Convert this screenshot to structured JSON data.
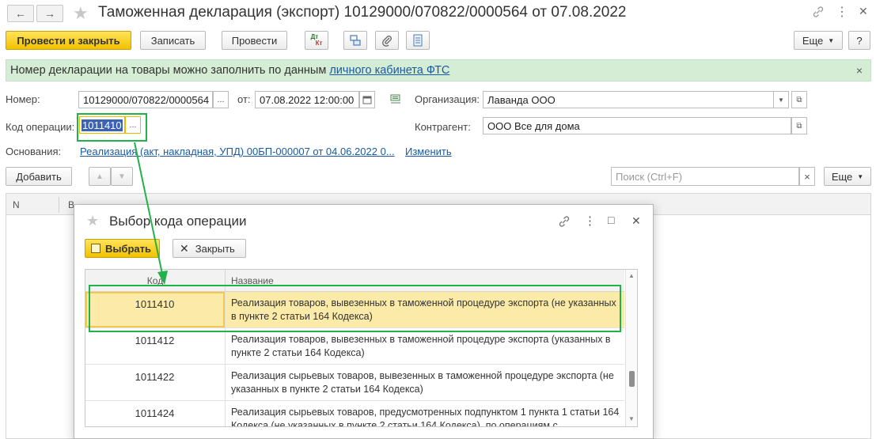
{
  "window": {
    "title": "Таможенная декларация (экспорт) 10129000/070822/0000564 от 07.08.2022",
    "back_glyph": "←",
    "forward_glyph": "→",
    "star_glyph": "★",
    "link_glyph": "🔗",
    "menu_glyph": "⋮",
    "maximize_glyph": "□",
    "close_glyph": "✕"
  },
  "toolbar": {
    "post_close": "Провести и закрыть",
    "save": "Записать",
    "post": "Провести",
    "dtkt_top": "Дт",
    "dtkt_bottom": "Кт",
    "more": "Еще",
    "help": "?"
  },
  "banner": {
    "text": "Номер декларации на товары можно заполнить по данным ",
    "link": "личного кабинета ФТС",
    "close_glyph": "×"
  },
  "form": {
    "number_label": "Номер:",
    "number_value": "10129000/070822/0000564",
    "date_label": "от:",
    "date_value": "07.08.2022 12:00:00",
    "org_label": "Организация:",
    "org_value": "Лаванда ООО",
    "opcode_label": "Код операции:",
    "opcode_value": "1011410",
    "contractor_label": "Контрагент:",
    "contractor_value": "ООО Все для дома",
    "basis_label": "Основания:",
    "basis_link": "Реализация (акт, накладная, УПД) 00БП-000007 от 04.06.2022 0...",
    "basis_change": "Изменить",
    "ellipsis": "..."
  },
  "table_toolbar": {
    "add": "Добавить",
    "search_placeholder": "Поиск (Ctrl+F)",
    "clear_glyph": "×",
    "more": "Еще"
  },
  "table": {
    "col_n": "N",
    "col_b": "В"
  },
  "dialog": {
    "title": "Выбор кода операции",
    "select": "Выбрать",
    "close": "Закрыть",
    "col_code": "Код",
    "col_name": "Название",
    "rows": [
      {
        "code": "1011410",
        "name": "Реализация товаров, вывезенных в таможенной процедуре экспорта (не указанных в пункте 2 статьи 164 Кодекса)"
      },
      {
        "code": "1011412",
        "name": "Реализация товаров, вывезенных в таможенной процедуре экспорта (указанных в пункте 2 статьи 164 Кодекса)"
      },
      {
        "code": "1011422",
        "name": "Реализация сырьевых товаров, вывезенных в таможенной процедуре экспорта (не указанных в пункте 2 статьи 164 Кодекса)"
      },
      {
        "code": "1011424",
        "name": "Реализация сырьевых товаров, предусмотренных подпунктом 1 пункта 1 статьи 164 Кодекса (не указанных в пункте 2 статьи 164 Кодекса), по операциям с"
      }
    ]
  },
  "colors": {
    "accent_yellow": "#f2c200",
    "banner_bg": "#d5ecd5",
    "highlight_green": "#22b24c",
    "selection_bg": "#fbeaa8"
  }
}
